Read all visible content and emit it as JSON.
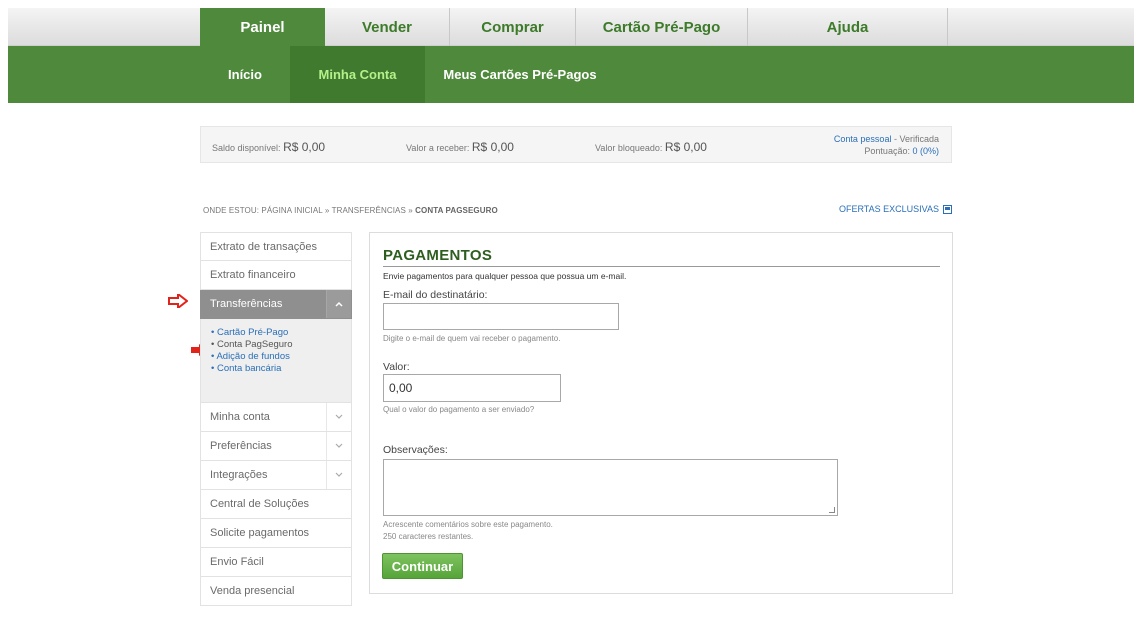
{
  "top_nav": {
    "tabs": [
      "Painel",
      "Vender",
      "Comprar",
      "Cartão Pré-Pago",
      "Ajuda"
    ]
  },
  "sub_nav": {
    "tabs": [
      "Início",
      "Minha Conta",
      "Meus Cartões Pré-Pagos"
    ]
  },
  "balance": {
    "available_label": "Saldo disponível:",
    "available_value": "R$ 0,00",
    "receivable_label": "Valor a receber:",
    "receivable_value": "R$ 0,00",
    "blocked_label": "Valor bloqueado:",
    "blocked_value": "R$ 0,00",
    "account_type": "Conta pessoal",
    "account_status": "- Verificada",
    "score_label": "Pontuação:",
    "score_value": "0 (0%)"
  },
  "breadcrumb": {
    "prefix": "ONDE ESTOU:",
    "home": "PÁGINA INICIAL",
    "sep1": "»",
    "section": "TRANSFERÊNCIAS",
    "sep2": "»",
    "current": "CONTA PAGSEGURO"
  },
  "offers_link": "OFERTAS EXCLUSIVAS",
  "sidebar": {
    "items_top": [
      "Extrato de transações",
      "Extrato financeiro"
    ],
    "active": "Transferências",
    "sub_items": [
      "Cartão Pré-Pago",
      "Conta PagSeguro",
      "Adição de fundos",
      "Conta bancária"
    ],
    "items_bottom": [
      "Minha conta",
      "Preferências",
      "Integrações",
      "Central de Soluções",
      "Solicite pagamentos",
      "Envio Fácil",
      "Venda presencial"
    ]
  },
  "form": {
    "title": "PAGAMENTOS",
    "lead": "Envie pagamentos para qualquer pessoa que possua um e-mail.",
    "email_label": "E-mail do destinatário:",
    "email_value": "",
    "email_hint": "Digite o e-mail de quem vai receber o pagamento.",
    "value_label": "Valor:",
    "value_value": "0,00",
    "value_hint": "Qual o valor do pagamento a ser enviado?",
    "notes_label": "Observações:",
    "notes_hint": "Acrescente comentários sobre este pagamento.",
    "chars_left": "250 caracteres restantes.",
    "submit_label": "Continuar"
  }
}
